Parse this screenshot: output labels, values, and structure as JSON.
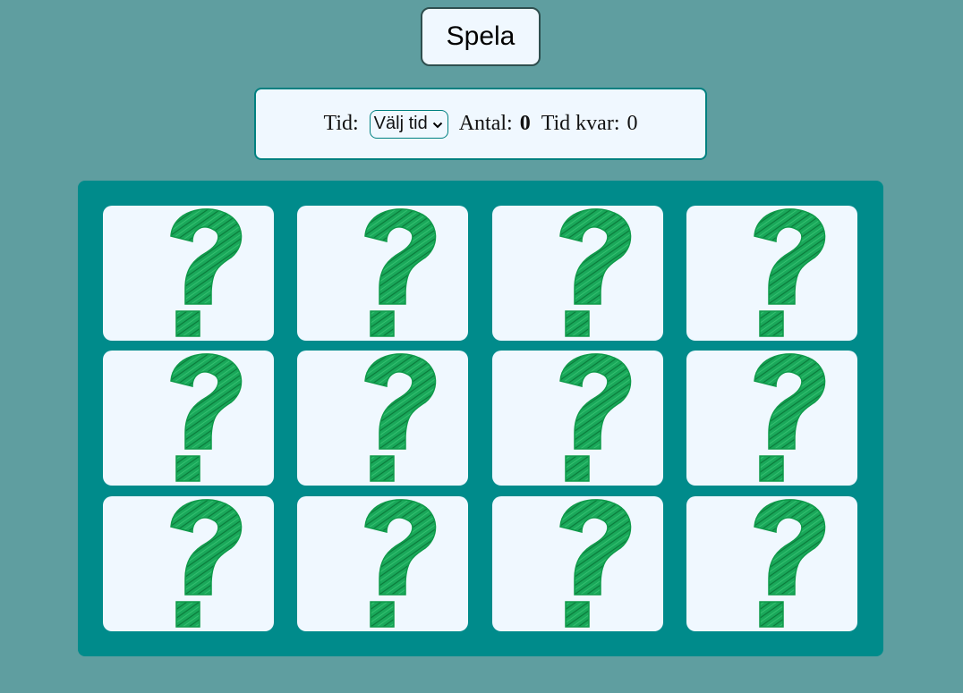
{
  "controls": {
    "play_label": "Spela"
  },
  "info": {
    "time_label": "Tid:",
    "time_select": {
      "selected": "Välj tid"
    },
    "count_label": "Antal:",
    "count_value": "0",
    "time_left_label": "Tid kvar:",
    "time_left_value": "0"
  },
  "board": {
    "rows": 3,
    "columns": 4,
    "cards": [
      {
        "state": "face-down",
        "icon": "question-mark-icon"
      },
      {
        "state": "face-down",
        "icon": "question-mark-icon"
      },
      {
        "state": "face-down",
        "icon": "question-mark-icon"
      },
      {
        "state": "face-down",
        "icon": "question-mark-icon"
      },
      {
        "state": "face-down",
        "icon": "question-mark-icon"
      },
      {
        "state": "face-down",
        "icon": "question-mark-icon"
      },
      {
        "state": "face-down",
        "icon": "question-mark-icon"
      },
      {
        "state": "face-down",
        "icon": "question-mark-icon"
      },
      {
        "state": "face-down",
        "icon": "question-mark-icon"
      },
      {
        "state": "face-down",
        "icon": "question-mark-icon"
      },
      {
        "state": "face-down",
        "icon": "question-mark-icon"
      },
      {
        "state": "face-down",
        "icon": "question-mark-icon"
      }
    ]
  },
  "colors": {
    "background": "#5f9ea0",
    "board": "#008b8b",
    "card": "#f0f8ff",
    "question_mark": "#0f9a4a"
  }
}
